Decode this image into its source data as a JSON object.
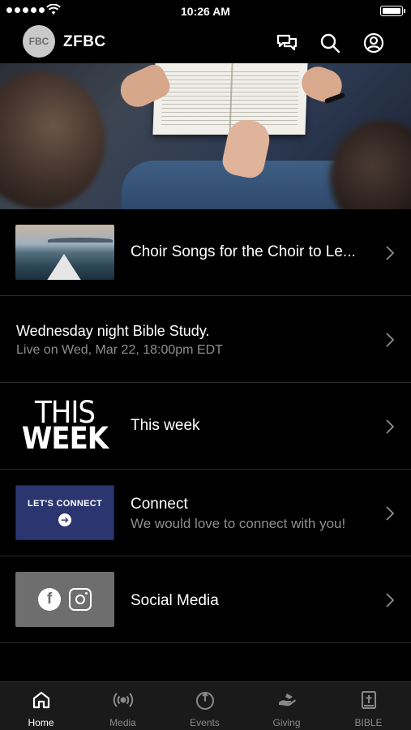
{
  "status_bar": {
    "time": "10:26 AM"
  },
  "header": {
    "title": "ZFBC",
    "logo_text": "FBC"
  },
  "items": [
    {
      "title": "Choir Songs for the Choir to Le...",
      "thumb": "lake-kayak"
    },
    {
      "title": "Wednesday night Bible Study.",
      "subtitle": "Live on Wed, Mar 22, 18:00pm EDT"
    },
    {
      "title": "This week",
      "thumb": "this-week",
      "thumb_line1": "THIS",
      "thumb_line2": "WEEK"
    },
    {
      "title": "Connect",
      "subtitle": "We would love to connect with you!",
      "thumb": "lets-connect",
      "thumb_text": "LET'S CONNECT"
    },
    {
      "title": "Social Media",
      "thumb": "social-icons",
      "thumb_fb": "f"
    }
  ],
  "tabs": [
    {
      "label": "Home",
      "icon": "home-icon",
      "active": true
    },
    {
      "label": "Media",
      "icon": "broadcast-icon"
    },
    {
      "label": "Events",
      "icon": "events-icon"
    },
    {
      "label": "Giving",
      "icon": "giving-icon"
    },
    {
      "label": "BIBLE",
      "icon": "bible-icon"
    }
  ],
  "colors": {
    "background": "#000000",
    "tabbar": "#1a1a1a",
    "subtitle": "#8e8e93",
    "connect_blue": "#2b3670"
  }
}
